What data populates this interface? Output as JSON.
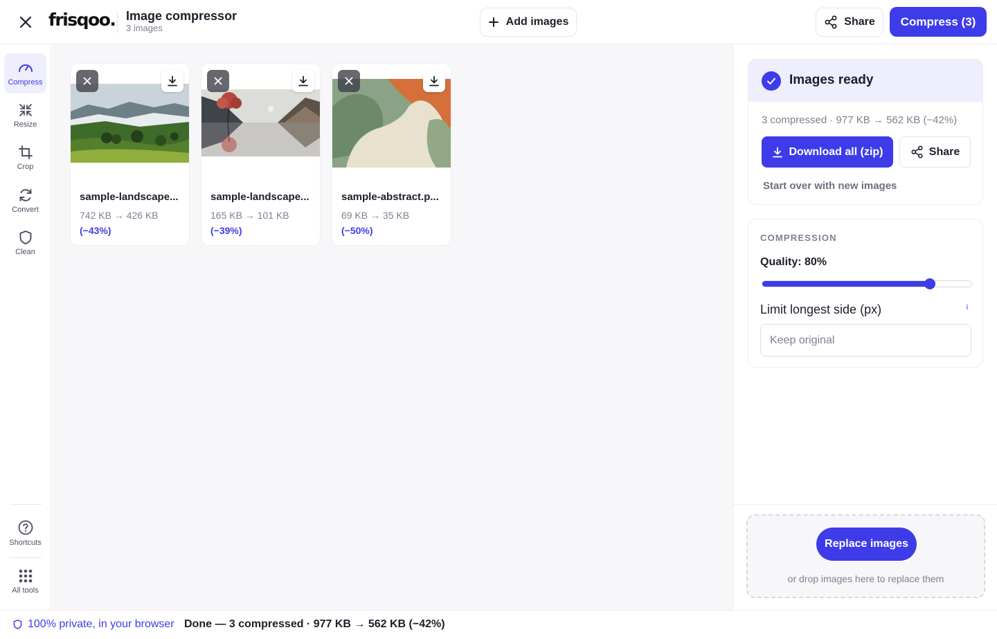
{
  "header": {
    "logo": "frisqoo.",
    "title": "Image compressor",
    "subtitle": "3 images",
    "add_images": "Add images",
    "share": "Share",
    "compress": "Compress (3)",
    "accent_color": "#3d3ce8"
  },
  "sidebar": {
    "items": [
      {
        "label": "Compress",
        "icon": "gauge-icon",
        "active": true
      },
      {
        "label": "Resize",
        "icon": "shrink-arrows-icon"
      },
      {
        "label": "Crop",
        "icon": "crop-icon"
      },
      {
        "label": "Convert",
        "icon": "refresh-icon"
      },
      {
        "label": "Clean",
        "icon": "shield-icon"
      }
    ],
    "bottom": [
      {
        "label": "Shortcuts",
        "icon": "help-circle-icon"
      },
      {
        "label": "All tools",
        "icon": "grid-dots-icon"
      }
    ]
  },
  "images": [
    {
      "name": "sample-landscape...",
      "size": "742 KB → 426 KB",
      "reduction": "(−43%)",
      "thumbnail": "misty-valley-landscape"
    },
    {
      "name": "sample-landscape...",
      "size": "165 KB → 101 KB",
      "reduction": "(−39%)",
      "thumbnail": "red-tree-lake-illustration"
    },
    {
      "name": "sample-abstract.p...",
      "size": "69 KB → 35 KB",
      "reduction": "(−50%)",
      "thumbnail": "abstract-color-shapes"
    }
  ],
  "panel": {
    "ready_title": "Images ready",
    "summary": "3 compressed · 977 KB → 562 KB (−42%)",
    "download_all": "Download all (zip)",
    "share": "Share",
    "start_over": "Start over with new images",
    "compression_heading": "COMPRESSION",
    "quality_label": "Quality: 80%",
    "quality_value": 0.8,
    "limit_label": "Limit longest side (px)",
    "info_icon_text": "i",
    "limit_placeholder": "Keep original",
    "replace_button": "Replace images",
    "drop_hint": "or drop images here to replace them"
  },
  "footer": {
    "privacy": "100% private, in your browser",
    "status": "Done — 3 compressed · 977 KB → 562 KB (−42%)"
  }
}
